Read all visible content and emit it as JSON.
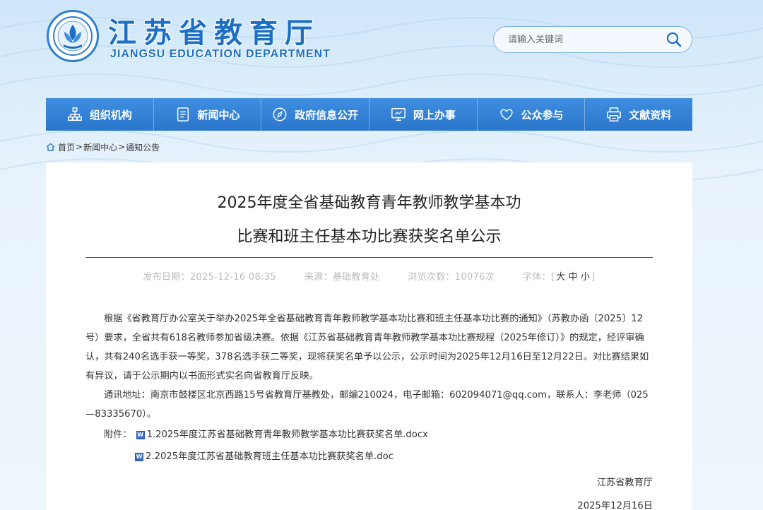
{
  "header": {
    "site_name": "江苏省教育厅",
    "site_name_en": "JIANGSU EDUCATION DEPARTMENT",
    "search_placeholder": "请输入关键词"
  },
  "nav": {
    "items": [
      {
        "label": "组织机构",
        "icon": "org-chart-icon"
      },
      {
        "label": "新闻中心",
        "icon": "document-list-icon"
      },
      {
        "label": "政府信息公开",
        "icon": "compass-icon"
      },
      {
        "label": "网上办事",
        "icon": "monitor-icon"
      },
      {
        "label": "公众参与",
        "icon": "heart-icon"
      },
      {
        "label": "文献资料",
        "icon": "printer-icon"
      }
    ]
  },
  "breadcrumb": {
    "home": "首页",
    "news": "新闻中心",
    "notice": "通知公告",
    "separator": ">"
  },
  "article": {
    "title_line1": "2025年度全省基础教育青年教师教学基本功",
    "title_line2": "比赛和班主任基本功比赛获奖名单公示",
    "publish_date": "发布日期：2025-12-16 08:35",
    "source": "来源：基础教育处",
    "views": "浏览次数：10076次",
    "font_label": "字体：[",
    "font_large": "大",
    "font_medium": "中",
    "font_small": "小",
    "font_close": "]",
    "paragraph1": "根据《省教育厅办公室关于举办2025年全省基础教育青年教师教学基本功比赛和班主任基本功比赛的通知》（苏教办函〔2025〕12号）要求，全省共有618名教师参加省级决赛。依据《江苏省基础教育青年教师教学基本功比赛规程（2025年修订）》的规定，经评审确认，共有240名选手获一等奖，378名选手获二等奖，现将获奖名单予以公示，公示时间为2025年12月16日至12月22日。对比赛结果如有异议，请于公示期内以书面形式实名向省教育厅反映。",
    "paragraph2": "通讯地址：南京市鼓楼区北京西路15号省教育厅基教处，邮编210024，电子邮箱：602094071@qq.com，联系人：李老师（025—83335670）。",
    "attach_label": "附件：",
    "attachment1": "1.2025年度江苏省基础教育青年教师教学基本功比赛获奖名单.docx",
    "attachment2": "2.2025年度江苏省基础教育班主任基本功比赛获奖名单.doc",
    "doc_icon_glyph": "W",
    "signature_org": "江苏省教育厅",
    "signature_date": "2025年12月16日"
  },
  "colors": {
    "brand_blue": "#1d6fc4",
    "nav_blue": "#2a76cc"
  }
}
